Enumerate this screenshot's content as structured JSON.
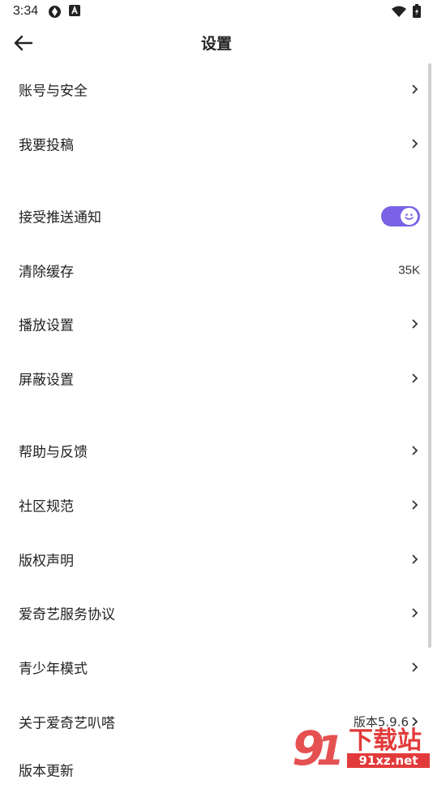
{
  "status": {
    "time": "3:34"
  },
  "header": {
    "title": "设置"
  },
  "items": [
    {
      "label": "账号与安全"
    },
    {
      "label": "我要投稿"
    },
    {
      "label": "接受推送通知",
      "toggle_on": true
    },
    {
      "label": "清除缓存",
      "value": "35K"
    },
    {
      "label": "播放设置"
    },
    {
      "label": "屏蔽设置"
    },
    {
      "label": "帮助与反馈"
    },
    {
      "label": "社区规范"
    },
    {
      "label": "版权声明"
    },
    {
      "label": "爱奇艺服务协议"
    },
    {
      "label": "青少年模式"
    },
    {
      "label": "关于爱奇艺叭嗒",
      "value": "版本5.9.6"
    },
    {
      "label": "版本更新"
    }
  ],
  "watermark": {
    "text": "下载站",
    "url_text": "91xz.net"
  },
  "colors": {
    "accent": "#7b61e6",
    "watermark_red": "#e23a3a"
  }
}
